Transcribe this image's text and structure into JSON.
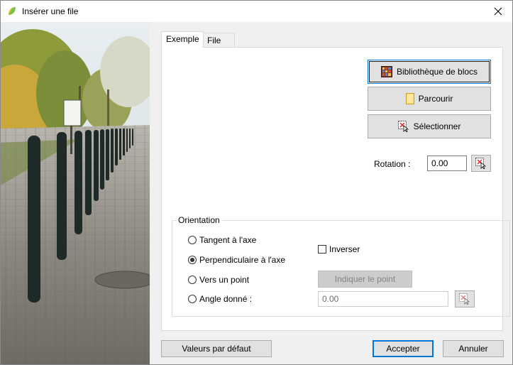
{
  "window": {
    "title": "Insérer une file"
  },
  "tabs": [
    {
      "label": "Exemple"
    },
    {
      "label": "File"
    }
  ],
  "buttons": {
    "bibliotheque": "Bibliothèque de blocs",
    "parcourir": "Parcourir",
    "selectionner": "Sélectionner",
    "indiquer_point": "Indiquer le point",
    "valeurs_defaut": "Valeurs par défaut",
    "accepter": "Accepter",
    "annuler": "Annuler"
  },
  "rotation": {
    "label": "Rotation :",
    "value": "0.00"
  },
  "orientation": {
    "title": "Orientation",
    "options": [
      {
        "label": "Tangent à l'axe",
        "selected": false
      },
      {
        "label": "Perpendiculaire à l'axe",
        "selected": true
      },
      {
        "label": "Vers un point",
        "selected": false
      },
      {
        "label": "Angle donné :",
        "selected": false
      }
    ],
    "inverser_label": "Inverser",
    "inverser_checked": false,
    "angle_value": "0.00"
  },
  "icons": {
    "app": "leaf-icon",
    "close": "close-icon",
    "library": "block-library-icon",
    "browse": "folder-icon",
    "select": "pick-cursor-icon"
  }
}
